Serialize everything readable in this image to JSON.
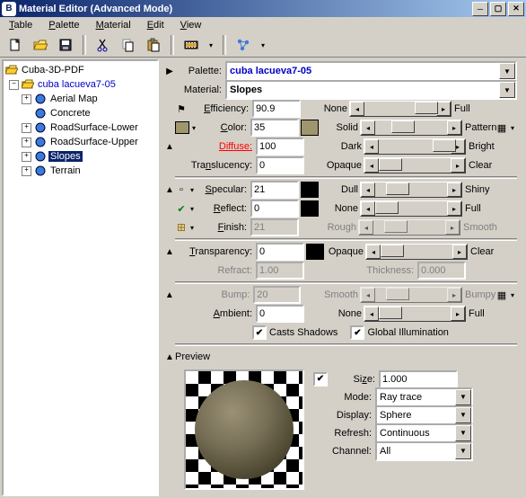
{
  "window": {
    "title": "Material Editor (Advanced Mode)"
  },
  "menus": [
    "Table",
    "Palette",
    "Material",
    "Edit",
    "View"
  ],
  "tree": {
    "root": "Cuba-3D-PDF",
    "palette": "cuba lacueva7-05",
    "items": [
      "Aerial Map",
      "Concrete",
      "RoadSurface-Lower",
      "RoadSurface-Upper",
      "Slopes",
      "Terrain"
    ],
    "selected": "Slopes"
  },
  "header": {
    "palette_label": "Palette:",
    "palette_value": "cuba lacueva7-05",
    "material_label": "Material:",
    "material_value": "Slopes"
  },
  "rows": {
    "efficiency": {
      "label": "Efficiency:",
      "value": "90.9",
      "left": "None",
      "right": "Full"
    },
    "color": {
      "label": "Color:",
      "value": "35",
      "left": "Solid",
      "right": "Pattern",
      "swatch1": "#9f966e",
      "swatch2": "#9f966e"
    },
    "diffuse": {
      "label": "Diffuse:",
      "value": "100",
      "left": "Dark",
      "right": "Bright"
    },
    "translucency": {
      "label": "Translucency:",
      "value": "0",
      "left": "Opaque",
      "right": "Clear"
    },
    "specular": {
      "label": "Specular:",
      "value": "21",
      "left": "Dull",
      "right": "Shiny",
      "swatch": "#000000"
    },
    "reflect": {
      "label": "Reflect:",
      "value": "0",
      "left": "None",
      "right": "Full",
      "swatch": "#000000"
    },
    "finish": {
      "label": "Finish:",
      "value": "21",
      "left": "Rough",
      "right": "Smooth"
    },
    "transparency": {
      "label": "Transparency:",
      "value": "0",
      "left": "Opaque",
      "right": "Clear",
      "swatch": "#000000"
    },
    "refract": {
      "label": "Refract:",
      "value": "1.00",
      "thick_label": "Thickness:",
      "thick_value": "0.000"
    },
    "bump": {
      "label": "Bump:",
      "value": "20",
      "left": "Smooth",
      "right": "Bumpy"
    },
    "ambient": {
      "label": "Ambient:",
      "value": "0",
      "left": "None",
      "right": "Full"
    }
  },
  "checks": {
    "shadows": "Casts Shadows",
    "gi": "Global Illumination"
  },
  "preview": {
    "header": "Preview",
    "size_label": "Size:",
    "size_value": "1.000",
    "mode_label": "Mode:",
    "mode_value": "Ray trace",
    "display_label": "Display:",
    "display_value": "Sphere",
    "refresh_label": "Refresh:",
    "refresh_value": "Continuous",
    "channel_label": "Channel:",
    "channel_value": "All"
  }
}
